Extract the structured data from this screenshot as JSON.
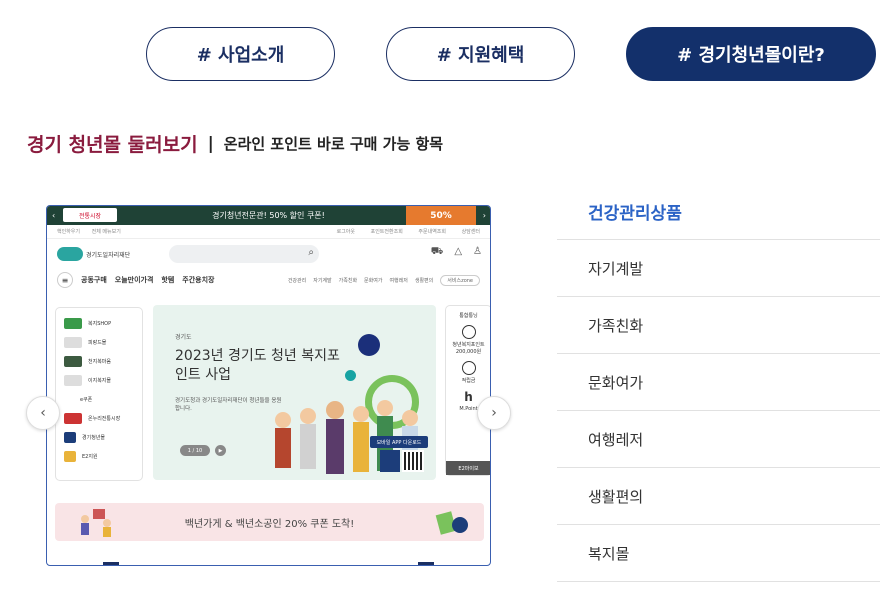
{
  "tabs": [
    {
      "label": "# 사업소개"
    },
    {
      "label": "# 지원혜택"
    },
    {
      "label": "# 경기청년몰이란?"
    }
  ],
  "heading": {
    "main": "경기 청년몰 둘러보기",
    "separator": "|",
    "sub": "온라인 포인트 바로 구매 가능 항목"
  },
  "preview": {
    "top_bar_text": "경기청년전문관! 50% 할인 쿠폰!",
    "top_bar_logo": "전통시장",
    "coupon_text": "50%",
    "util_left": [
      "핵인하우기",
      "전체 메뉴보기"
    ],
    "util_right": [
      "로그아웃",
      "포인트전환조회",
      "주문내역조회",
      "상담센터"
    ],
    "logo_text": "경기도일자리재단",
    "nav": [
      "공동구매",
      "오늘만이가격",
      "핫템",
      "주간용치장"
    ],
    "nav_cats": [
      "건강관리",
      "자기계발",
      "가족친화",
      "문화여가",
      "여행레저",
      "생활편의"
    ],
    "nav_pill": "서비스zone",
    "side": [
      "복지SHOP",
      "피랑드몰",
      "천지복마움",
      "이지복지몰",
      "e쿠폰",
      "온누리전통시장",
      "경기청년몰",
      "E2지원"
    ],
    "banner_tag": "경기도",
    "banner_title": "2023년 경기도 청년 복지포인트 사업",
    "banner_desc": "경기도청과 경기도일자리재단이 청년들을 응원합니다.",
    "banner_pager": "1 / 10",
    "app_badge": "모바일 APP 다운로드",
    "right_panel": [
      "통합통닝",
      "청년복지포인트 200,000원",
      "적립금",
      "M.Point",
      "E2마이보"
    ],
    "strip_text": "백년가게 & 백년소공인 20% 쿠폰 도착!"
  },
  "categories": [
    {
      "label": "건강관리상품",
      "active": true
    },
    {
      "label": "자기계발",
      "active": false
    },
    {
      "label": "가족친화",
      "active": false
    },
    {
      "label": "문화여가",
      "active": false
    },
    {
      "label": "여행레저",
      "active": false
    },
    {
      "label": "생활편의",
      "active": false
    },
    {
      "label": "복지몰",
      "active": false
    }
  ],
  "colors": {
    "navy": "#13306b",
    "accent_red": "#8a1b3e",
    "active_blue": "#2b63c6"
  }
}
